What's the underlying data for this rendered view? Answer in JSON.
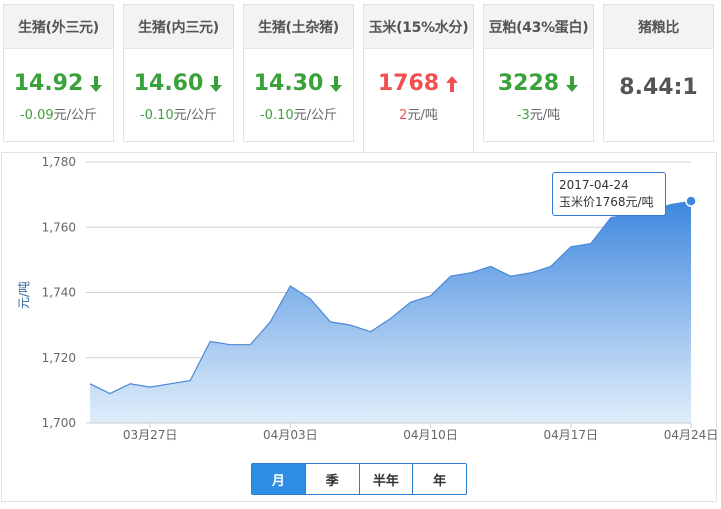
{
  "cards": [
    {
      "title": "生猪(外三元)",
      "price": "14.92",
      "direction": "down",
      "change": "-0.09",
      "unit": "元/公斤"
    },
    {
      "title": "生猪(内三元)",
      "price": "14.60",
      "direction": "down",
      "change": "-0.10",
      "unit": "元/公斤"
    },
    {
      "title": "生猪(土杂猪)",
      "price": "14.30",
      "direction": "down",
      "change": "-0.10",
      "unit": "元/公斤"
    },
    {
      "title": "玉米(15%水分)",
      "price": "1768",
      "direction": "up",
      "change": "2",
      "unit": "元/吨",
      "active": true
    },
    {
      "title": "豆粕(43%蛋白)",
      "price": "3228",
      "direction": "down",
      "change": "-3",
      "unit": "元/吨"
    },
    {
      "title": "猪粮比",
      "price": "8.44:1",
      "direction": "none"
    }
  ],
  "colors": {
    "down": "#3aa23a",
    "up": "#f05050",
    "accent": "#2e8ee6",
    "line": "#4a88d8"
  },
  "tooltip": {
    "date": "2017-04-24",
    "text": "玉米价1768元/吨"
  },
  "range_tabs": [
    {
      "label": "月",
      "active": true
    },
    {
      "label": "季",
      "active": false
    },
    {
      "label": "半年",
      "active": false
    },
    {
      "label": "年",
      "active": false
    }
  ],
  "chart_data": {
    "type": "area",
    "ylabel": "元/吨",
    "ylim": [
      1700,
      1780
    ],
    "yticks": [
      1700,
      1720,
      1740,
      1760,
      1780
    ],
    "ytick_labels": [
      "1,700",
      "1,720",
      "1,740",
      "1,760",
      "1,780"
    ],
    "xtick_labels": [
      "03月27日",
      "04月03日",
      "04月10日",
      "04月17日",
      "04月24日"
    ],
    "xtick_index": [
      3,
      10,
      17,
      24,
      31
    ],
    "grid": true,
    "series": [
      {
        "values": [
          1712,
          1709,
          1712,
          1711,
          1712,
          1713,
          1725,
          1724,
          1724,
          1731,
          1742,
          1738,
          1731,
          1730,
          1728,
          1732,
          1737,
          1739,
          1745,
          1746,
          1748,
          1745,
          1746,
          1748,
          1754,
          1755,
          1763,
          1764,
          1765,
          1767,
          1768
        ]
      }
    ],
    "highlight_index": 30
  }
}
